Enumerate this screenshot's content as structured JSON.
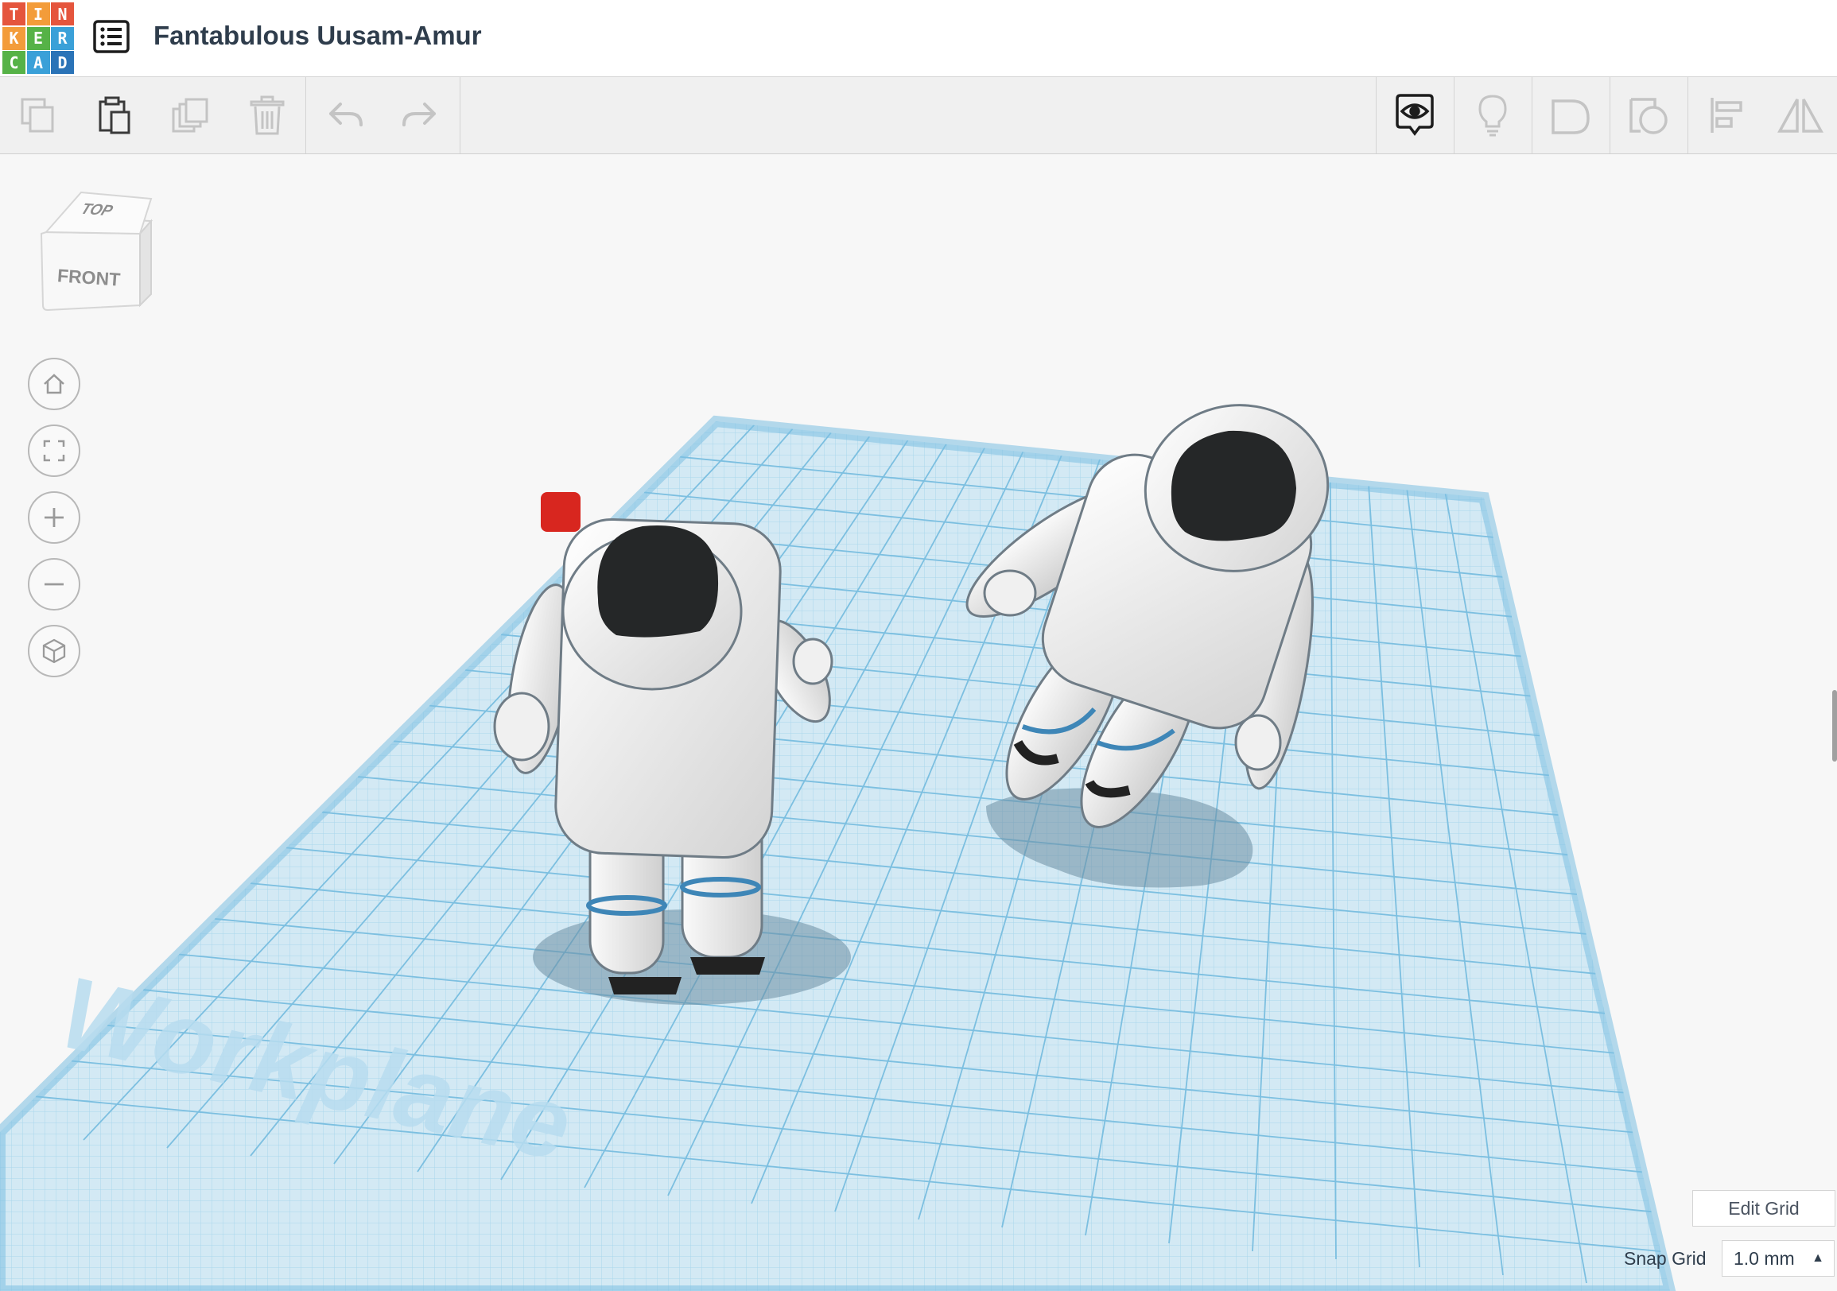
{
  "logo": {
    "letters": [
      "T",
      "I",
      "N",
      "K",
      "E",
      "R",
      "C",
      "A",
      "D"
    ],
    "colors": [
      "#e5553d",
      "#f39c3a",
      "#e5553d",
      "#f39c3a",
      "#56b247",
      "#3aa0d8",
      "#56b247",
      "#3aa0d8",
      "#2a73b7"
    ]
  },
  "header": {
    "title": "Fantabulous Uusam-Amur",
    "menu_icon": "list-icon"
  },
  "toolbar": {
    "left_icons": [
      "copy-icon",
      "paste-icon",
      "duplicate-icon",
      "delete-icon",
      "undo-icon",
      "redo-icon"
    ],
    "right_icons": [
      "notes-eye-icon",
      "bulb-icon",
      "shape-icon",
      "hole-icon",
      "align-icon",
      "mirror-icon"
    ]
  },
  "view_cube": {
    "top": "TOP",
    "front": "FRONT"
  },
  "nav": [
    "home-icon",
    "fit-view-icon",
    "zoom-in-icon",
    "zoom-out-icon",
    "ortho-view-icon"
  ],
  "workplane": {
    "label": "Workplane"
  },
  "controls": {
    "edit_grid": "Edit Grid",
    "snap_label": "Snap Grid",
    "snap_value": "1.0 mm"
  },
  "colors": {
    "grid_fill": "#d5eaf5",
    "grid_line": "#8cc7e4",
    "accent": "#2a73b7"
  }
}
